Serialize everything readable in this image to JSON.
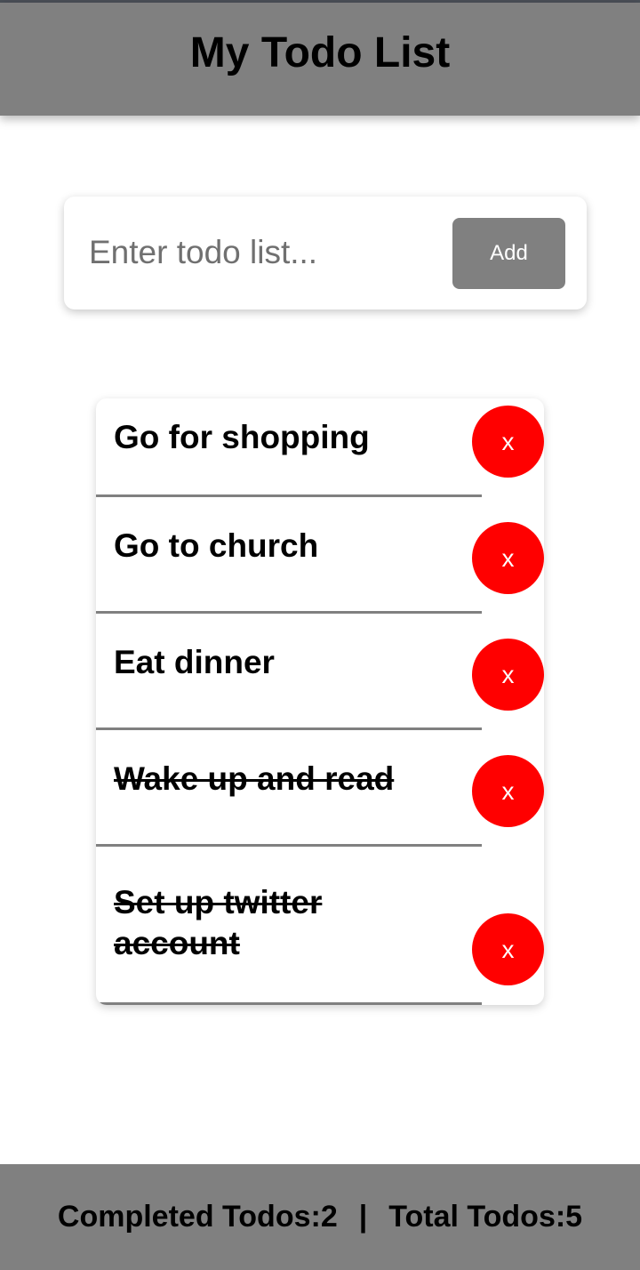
{
  "header": {
    "title": "My Todo List"
  },
  "input": {
    "placeholder": "Enter todo list...",
    "value": "",
    "add_label": "Add"
  },
  "todos": [
    {
      "text": "Go for shopping",
      "completed": false,
      "delete_label": "x"
    },
    {
      "text": "Go to church",
      "completed": false,
      "delete_label": "x"
    },
    {
      "text": "Eat dinner",
      "completed": false,
      "delete_label": "x"
    },
    {
      "text": "Wake up and read",
      "completed": true,
      "delete_label": "x"
    },
    {
      "text": "Set up twitter account",
      "completed": true,
      "delete_label": "x"
    }
  ],
  "footer": {
    "completed_label": "Completed Todos:2",
    "separator": "|",
    "total_label": "Total Todos:5"
  },
  "colors": {
    "header_bg": "#808080",
    "footer_bg": "#808080",
    "add_button_bg": "#808080",
    "delete_button_bg": "#ff0000",
    "divider": "#808080"
  }
}
